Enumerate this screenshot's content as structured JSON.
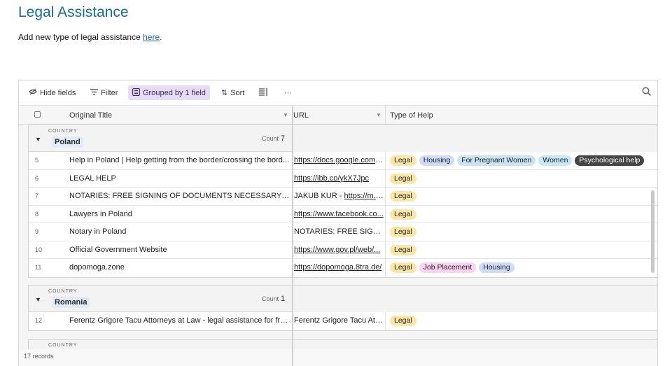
{
  "page": {
    "title": "Legal Assistance",
    "description_prefix": "Add new type of legal assistance ",
    "description_link": "here",
    "description_suffix": "."
  },
  "toolbar": {
    "hide_fields": "Hide fields",
    "filter": "Filter",
    "grouped": "Grouped by 1 field",
    "sort": "Sort",
    "more": "···"
  },
  "columns": {
    "title": "Original Title",
    "url": "URL",
    "type": "Type of Help"
  },
  "colors": {
    "Legal": "#fbe6a8",
    "Housing": "#d0dcf7",
    "For Pregnant Women": "#cce3f5",
    "Women": "#c9e8f7",
    "Psychological help": "#444444",
    "Job Placement": "#f9d3ef"
  },
  "groups": [
    {
      "label": "COUNTRY",
      "name": "Poland",
      "count_label": "Count",
      "count": "7",
      "rows": [
        {
          "num": "5",
          "title": "Help in Poland | Help getting from the border/crossing the bord...",
          "url_text": "https://docs.google.com/...",
          "tags": [
            "Legal",
            "Housing",
            "For Pregnant Women",
            "Women",
            "Psychological help"
          ]
        },
        {
          "num": "6",
          "title": "LEGAL HELP",
          "url_text": "https://ibb.co/ykX7Jpc",
          "tags": [
            "Legal"
          ]
        },
        {
          "num": "7",
          "title": "NOTARIES: FREE SIGNING OF DOCUMENTS NECESSARY FOR I...",
          "url_prefix": "JAKUB KUR - ",
          "url_text": "https://m.fa...",
          "tags": [
            "Legal"
          ]
        },
        {
          "num": "8",
          "title": "Lawyers in Poland",
          "url_text": "https://www.facebook.co...",
          "tags": [
            "Legal"
          ]
        },
        {
          "num": "9",
          "title": "Notary in Poland",
          "url_prefix": "NOTARIES: FREE SIGNIN...",
          "url_text": "",
          "tags": [
            "Legal"
          ]
        },
        {
          "num": "10",
          "title": "Official Government Website",
          "url_text": "https://www.gov.pl/web/...",
          "tags": [
            "Legal"
          ]
        },
        {
          "num": "11",
          "title": "dopomoga.zone",
          "url_text": "https://dopomoga.8tra.de/",
          "tags": [
            "Legal",
            "Job Placement",
            "Housing"
          ]
        }
      ]
    },
    {
      "label": "COUNTRY",
      "name": "Romania",
      "count_label": "Count",
      "count": "1",
      "rows": [
        {
          "num": "12",
          "title": "Ferentz Grigore Tacu Attorneys at Law - legal assistance for fre...",
          "url_prefix": "Ferentz Grigore Tacu Atto...",
          "url_text": "",
          "tags": [
            "Legal"
          ]
        }
      ]
    }
  ],
  "group3_label": "COUNTRY",
  "footer": "17 records"
}
